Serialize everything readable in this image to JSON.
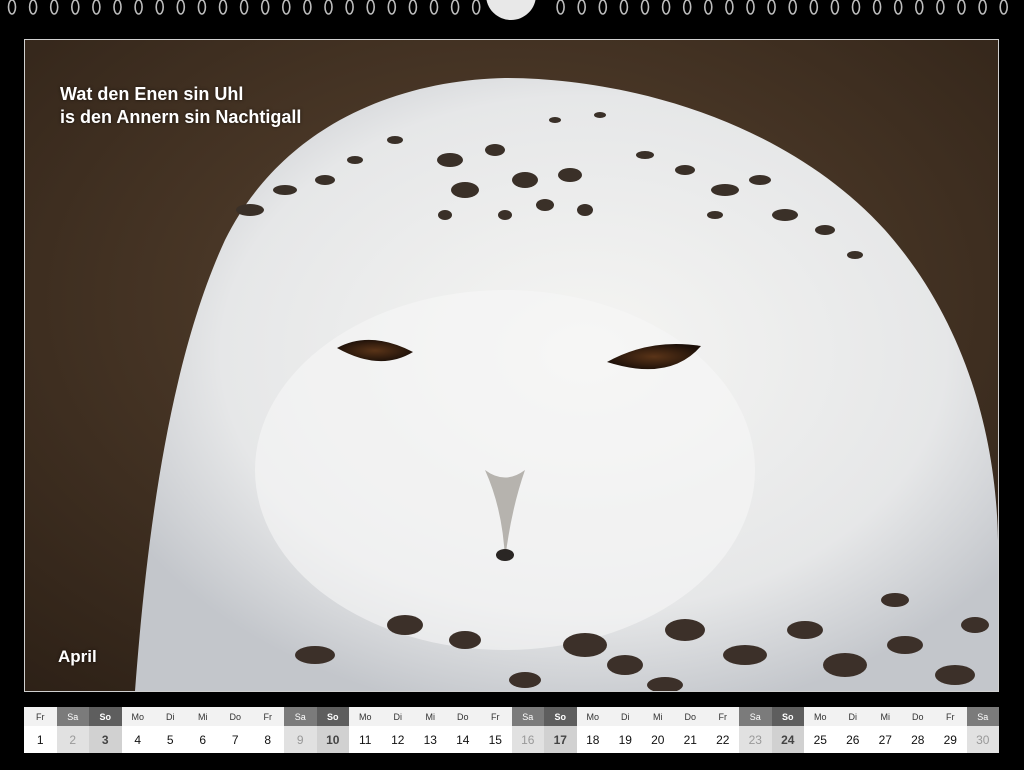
{
  "quote": {
    "line1": "Wat den Enen sin Uhl",
    "line2": "is den Annern sin Nachtigall"
  },
  "month": "April",
  "calendar": [
    {
      "wd": "Fr",
      "d": "1",
      "type": "wk"
    },
    {
      "wd": "Sa",
      "d": "2",
      "type": "sa"
    },
    {
      "wd": "So",
      "d": "3",
      "type": "so"
    },
    {
      "wd": "Mo",
      "d": "4",
      "type": "wk"
    },
    {
      "wd": "Di",
      "d": "5",
      "type": "wk"
    },
    {
      "wd": "Mi",
      "d": "6",
      "type": "wk"
    },
    {
      "wd": "Do",
      "d": "7",
      "type": "wk"
    },
    {
      "wd": "Fr",
      "d": "8",
      "type": "wk"
    },
    {
      "wd": "Sa",
      "d": "9",
      "type": "sa"
    },
    {
      "wd": "So",
      "d": "10",
      "type": "so"
    },
    {
      "wd": "Mo",
      "d": "11",
      "type": "wk"
    },
    {
      "wd": "Di",
      "d": "12",
      "type": "wk"
    },
    {
      "wd": "Mi",
      "d": "13",
      "type": "wk"
    },
    {
      "wd": "Do",
      "d": "14",
      "type": "wk"
    },
    {
      "wd": "Fr",
      "d": "15",
      "type": "wk"
    },
    {
      "wd": "Sa",
      "d": "16",
      "type": "sa"
    },
    {
      "wd": "So",
      "d": "17",
      "type": "so"
    },
    {
      "wd": "Mo",
      "d": "18",
      "type": "wk"
    },
    {
      "wd": "Di",
      "d": "19",
      "type": "wk"
    },
    {
      "wd": "Mi",
      "d": "20",
      "type": "wk"
    },
    {
      "wd": "Do",
      "d": "21",
      "type": "wk"
    },
    {
      "wd": "Fr",
      "d": "22",
      "type": "wk"
    },
    {
      "wd": "Sa",
      "d": "23",
      "type": "sa"
    },
    {
      "wd": "So",
      "d": "24",
      "type": "so"
    },
    {
      "wd": "Mo",
      "d": "25",
      "type": "wk"
    },
    {
      "wd": "Di",
      "d": "26",
      "type": "wk"
    },
    {
      "wd": "Mi",
      "d": "27",
      "type": "wk"
    },
    {
      "wd": "Do",
      "d": "28",
      "type": "wk"
    },
    {
      "wd": "Fr",
      "d": "29",
      "type": "wk"
    },
    {
      "wd": "Sa",
      "d": "30",
      "type": "sa"
    }
  ]
}
